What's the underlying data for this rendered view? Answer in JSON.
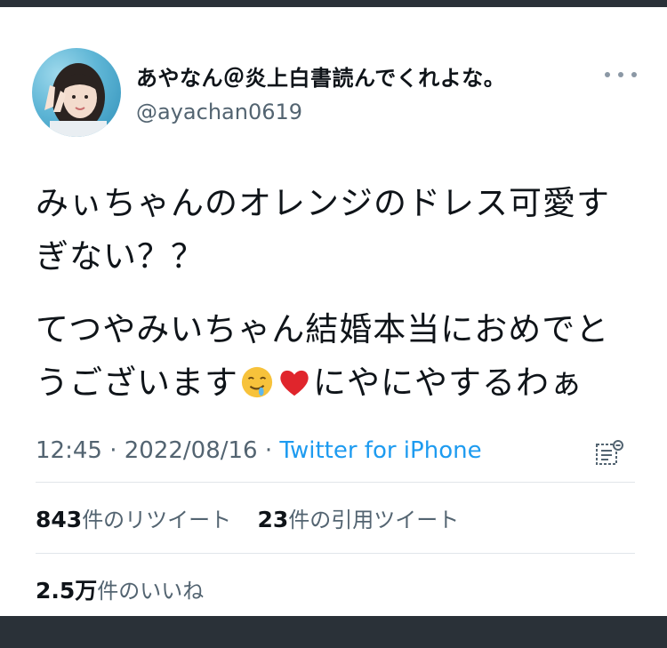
{
  "user": {
    "display_name": "あやなん＠炎上白書読んでくれよな。",
    "handle": "@ayachan0619"
  },
  "tweet": {
    "line1": "みぃちゃんのオレンジのドレス可愛す",
    "line2": "ぎない？？",
    "line3": "てつやみいちゃん結婚本当におめでと",
    "line4_before": "うございます",
    "line4_after": "にやにやするわぁ",
    "emojis": [
      "drooling-face-emoji",
      "red-heart-emoji"
    ]
  },
  "meta": {
    "time": "12:45",
    "sep1": " · ",
    "date": "2022/08/16",
    "sep2": " · ",
    "source": "Twitter for iPhone"
  },
  "stats": {
    "retweets_count": "843",
    "retweets_label": "件のリツイート",
    "quotes_count": "23",
    "quotes_label": "件の引用ツイート",
    "likes_count": "2.5万",
    "likes_label": "件のいいね"
  },
  "colors": {
    "text": "#0f1419",
    "secondary": "#536471",
    "link": "#1d9bf0",
    "divider": "#e1e6ea"
  }
}
